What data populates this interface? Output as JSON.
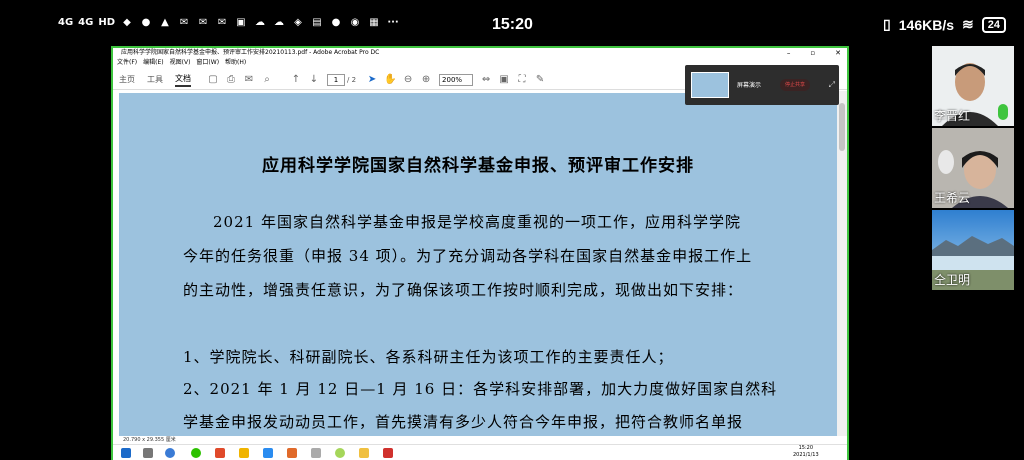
{
  "status_bar": {
    "left_icons": [
      "4G",
      "4G",
      "HD",
      "dingtalk-icon",
      "wechat-icon",
      "qq-icon",
      "mail-icon",
      "mail-icon",
      "mail-icon",
      "app-icon",
      "cloud-icon",
      "cloud-icon",
      "security-icon",
      "photo-icon",
      "location-icon",
      "qq-icon",
      "app-icon",
      "more-icon"
    ],
    "left_labels": [
      "4G",
      "4G",
      "HD"
    ],
    "time": "15:20",
    "net_speed": "146KB/s",
    "battery": "24"
  },
  "acrobat": {
    "title": "应用科学学院国家自然科学基金申报、预评审工作安排20210113.pdf - Adobe Acrobat Pro DC",
    "menu": [
      "文件(F)",
      "编辑(E)",
      "视图(V)",
      "窗口(W)",
      "帮助(H)"
    ],
    "tabs": [
      "主页",
      "工具",
      "文档"
    ],
    "active_tab": "文档",
    "page_current": "1",
    "page_total": "/ 2",
    "zoom": "200%",
    "page_size": "20.790 x 29.355 厘米"
  },
  "document": {
    "title": "应用科学学院国家自然科学基金申报、预评审工作安排",
    "lines": [
      "2021 年国家自然科学基金申报是学校高度重视的一项工作，应用科学学院",
      "今年的任务很重（申报 34 项）。为了充分调动各学科在国家自然基金申报工作上",
      "的主动性，增强责任意识，为了确保该项工作按时顺利完成，现做出如下安排：",
      "1、学院院长、科研副院长、各系科研主任为该项工作的主要责任人；",
      "2、2021 年 1 月 12 日—1 月 16 日：各学科安排部署，加大力度做好国家自然科",
      "学基金申报发动动员工作，首先摸清有多少人符合今年申报，把符合教师名单报"
    ]
  },
  "share_popup": {
    "label": "屏幕演示",
    "stop_label": "停止共享"
  },
  "taskbar": {
    "clock_time": "15:20",
    "clock_date": "2021/1/13"
  },
  "participants": [
    {
      "name": "李晋红",
      "mic_active": true
    },
    {
      "name": "王希云",
      "mic_active": false
    },
    {
      "name": "仝卫明",
      "mic_active": false
    }
  ]
}
